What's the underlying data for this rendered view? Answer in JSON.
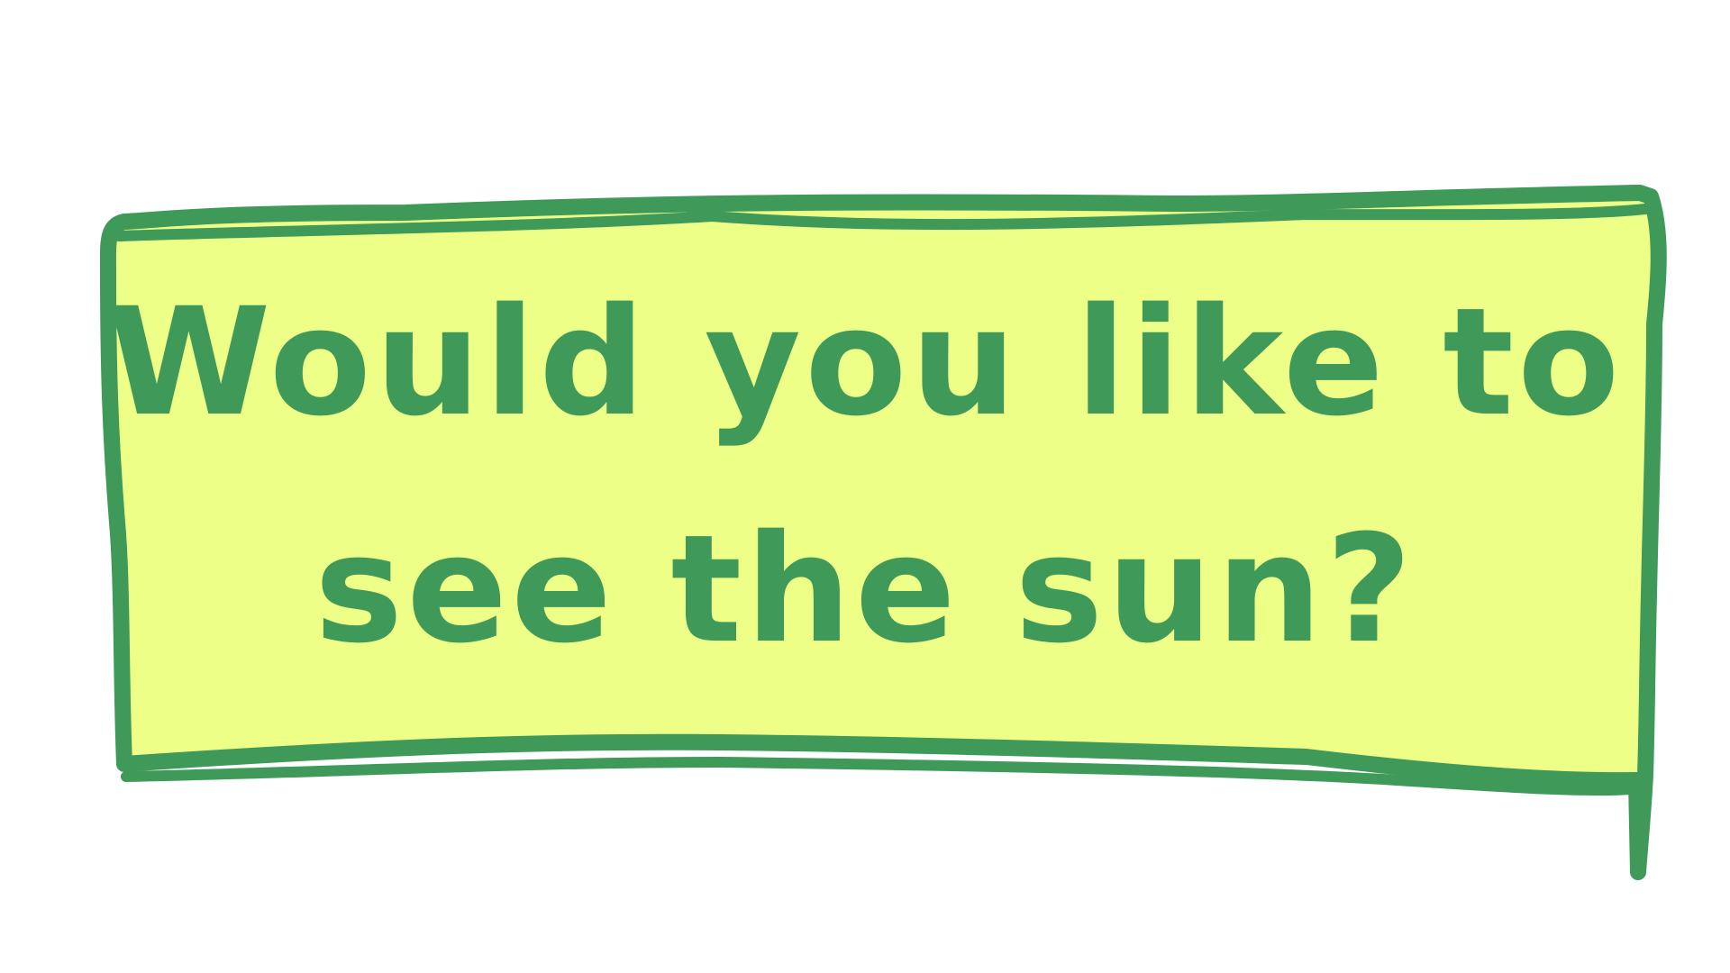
{
  "message": {
    "line_1": "Would you like to",
    "line_2": "see the sun?"
  },
  "colors": {
    "background": "#ffffff",
    "sign_fill": "#eeff88",
    "sign_border": "#3f9a5a",
    "text": "#3f9a5a"
  }
}
